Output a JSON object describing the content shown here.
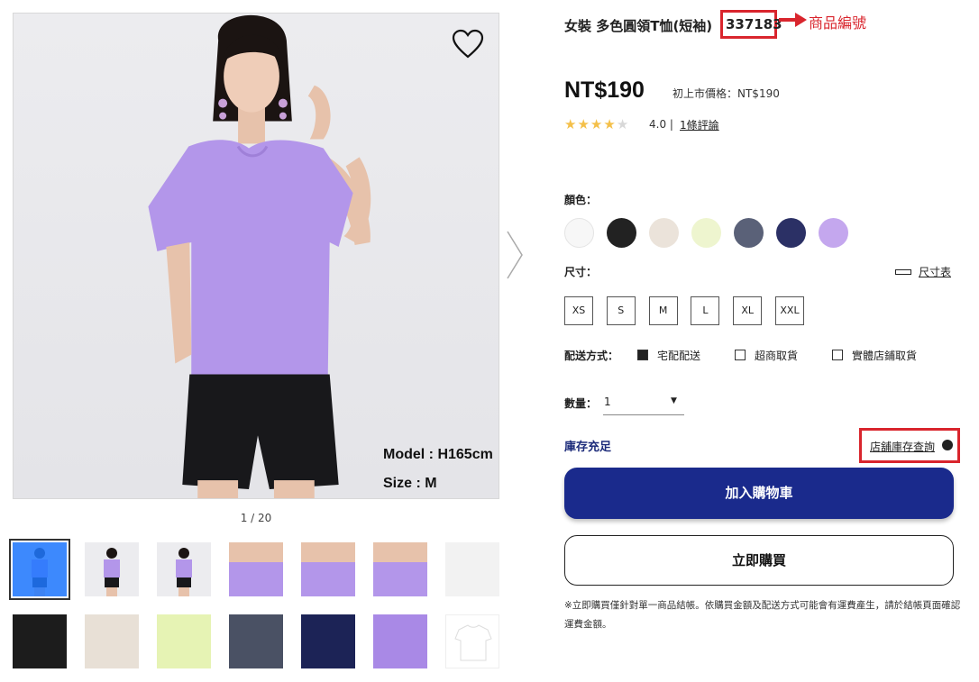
{
  "gallery": {
    "pager": "1 / 20",
    "model_caption": "Model : H165cm",
    "size_caption": "Size : M",
    "thumbnails": [
      {
        "kind": "model",
        "color": "#b396ea"
      },
      {
        "kind": "side",
        "color": "#b396ea"
      },
      {
        "kind": "back",
        "color": "#b396ea"
      },
      {
        "kind": "detail-top",
        "color": "#b396ea"
      },
      {
        "kind": "detail-sleeve",
        "color": "#b396ea"
      },
      {
        "kind": "detail-hem",
        "color": "#b396ea"
      },
      {
        "kind": "fabric",
        "color": "#f2f2f2"
      },
      {
        "kind": "fabric",
        "color": "#1c1c1c"
      },
      {
        "kind": "fabric",
        "color": "#e8e0d6"
      },
      {
        "kind": "fabric",
        "color": "#e6f3b4"
      },
      {
        "kind": "fabric",
        "color": "#4a5164"
      },
      {
        "kind": "fabric",
        "color": "#1c2356"
      },
      {
        "kind": "fabric",
        "color": "#a989e6"
      },
      {
        "kind": "flat-shirt",
        "color": "#ffffff"
      }
    ]
  },
  "product": {
    "title": "女裝 多色圓領T恤(短袖)",
    "code": "337183",
    "annotation": "商品編號",
    "price": "NT$190",
    "original_price": "初上市價格：NT$190",
    "rating": 4,
    "rating_text": "4.0 | ",
    "review_link": "1條評論"
  },
  "color": {
    "label": "顏色：",
    "swatches": [
      "#f7f7f7",
      "#222222",
      "#ebe3da",
      "#eef5cf",
      "#5a6178",
      "#2b3065",
      "#c4a7ee"
    ]
  },
  "size": {
    "label": "尺寸：",
    "chart_link": "尺寸表",
    "options": [
      "XS",
      "S",
      "M",
      "L",
      "XL",
      "XXL"
    ]
  },
  "shipping": {
    "label": "配送方式：",
    "options": [
      {
        "label": "宅配配送",
        "checked": true
      },
      {
        "label": "超商取貨",
        "checked": false
      },
      {
        "label": "實體店鋪取貨",
        "checked": false
      }
    ]
  },
  "quantity": {
    "label": "數量：",
    "value": "1"
  },
  "stock": {
    "status": "庫存充足",
    "store_link": "店舖庫存查詢"
  },
  "actions": {
    "add_to_cart": "加入購物車",
    "buy_now": "立即購買"
  },
  "note": "※立即購買僅針對單一商品結帳。依購買金額及配送方式可能會有運費產生，請於結帳頁面確認運費金額。",
  "colors": {
    "primary": "#1a2a8c",
    "annotation": "#d9252d",
    "star": "#f4c04a"
  }
}
